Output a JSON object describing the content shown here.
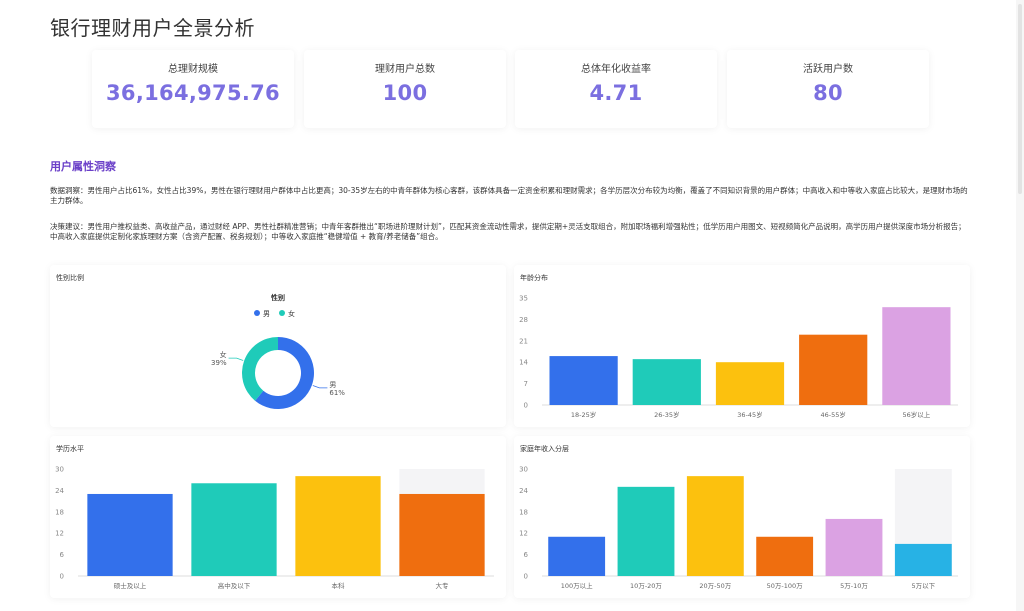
{
  "title": "银行理财用户全景分析",
  "kpis": [
    {
      "label": "总理财规模",
      "value": "36,164,975.76"
    },
    {
      "label": "理财用户总数",
      "value": "100"
    },
    {
      "label": "总体年化收益率",
      "value": "4.71"
    },
    {
      "label": "活跃用户数",
      "value": "80"
    }
  ],
  "insights": {
    "title": "用户属性洞察",
    "paragraph1": "数据洞察：男性用户占比61%，女性占比39%，男性在银行理财用户群体中占比更高；30-35岁左右的中青年群体为核心客群，该群体具备一定资金积累和理财需求；各学历层次分布较为均衡，覆盖了不同知识背景的用户群体；中高收入和中等收入家庭占比较大，是理财市场的主力群体。",
    "paragraph2": "决策建议：男性用户推权益类、高收益产品，通过财经 APP、男性社群精准营销；中青年客群推出“职场进阶理财计划”，匹配其资金流动性需求，提供定期+灵活支取组合，附加职场福利增强粘性；低学历用户用图文、短视频简化产品说明，高学历用户提供深度市场分析报告；中高收入家庭提供定制化家族理财方案（含资产配置、税务规划）；中等收入家庭推“稳健增值 + 教育/养老储备”组合。"
  },
  "colors": {
    "accent": "#7b6fe0",
    "section": "#6a3fc8",
    "palette": [
      "#3370eb",
      "#1fcbb9",
      "#fcc10e",
      "#ef6e0f",
      "#dba2e3",
      "#27b2e5"
    ],
    "track": "#f4f4f6"
  },
  "chart_data": [
    {
      "type": "pie",
      "title": "性别比例",
      "legend_title": "性别",
      "legend_position": "top",
      "categories": [
        "男",
        "女"
      ],
      "values": [
        61,
        39
      ],
      "value_labels": [
        "61%",
        "39%"
      ]
    },
    {
      "type": "bar",
      "title": "年龄分布",
      "categories": [
        "18-25岁",
        "26-35岁",
        "36-45岁",
        "46-55岁",
        "56岁以上"
      ],
      "values": [
        16,
        15,
        14,
        23,
        32
      ],
      "ylim": [
        0,
        35
      ],
      "yticks": [
        0,
        7,
        14,
        21,
        28,
        35
      ],
      "grid": false,
      "track_index": -1
    },
    {
      "type": "bar",
      "title": "学历水平",
      "categories": [
        "硕士及以上",
        "高中及以下",
        "本科",
        "大专"
      ],
      "values": [
        23,
        26,
        28,
        23
      ],
      "ylim": [
        0,
        30
      ],
      "yticks": [
        0,
        6,
        12,
        18,
        24,
        30
      ],
      "grid": false,
      "track_index": 3
    },
    {
      "type": "bar",
      "title": "家庭年收入分层",
      "categories": [
        "100万以上",
        "10万-20万",
        "20万-50万",
        "50万-100万",
        "5万-10万",
        "5万以下"
      ],
      "values": [
        11,
        25,
        28,
        11,
        16,
        9
      ],
      "ylim": [
        0,
        30
      ],
      "yticks": [
        0,
        6,
        12,
        18,
        24,
        30
      ],
      "grid": false,
      "track_index": 5
    }
  ]
}
